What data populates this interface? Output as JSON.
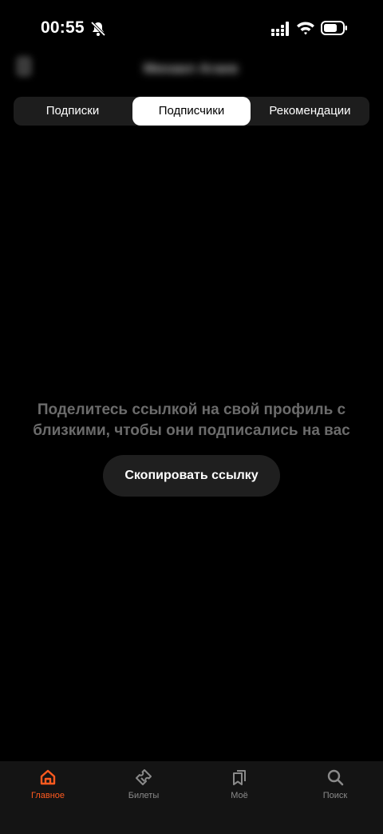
{
  "status_bar": {
    "time": "00:55",
    "icons": [
      "bell-off-icon",
      "signal-icon",
      "wifi-icon",
      "battery-icon"
    ]
  },
  "header": {
    "title": "Михаил Агаев",
    "back_icon": "chevron-left-icon"
  },
  "tabs": [
    {
      "label": "Подписки",
      "active": false
    },
    {
      "label": "Подписчики",
      "active": true
    },
    {
      "label": "Рекомендации",
      "active": false
    }
  ],
  "empty_state": {
    "line1": "Поделитесь ссылкой на свой профиль с",
    "line2": "близкими, чтобы они подписались на вас",
    "button_label": "Скопировать ссылку"
  },
  "bottom_nav": [
    {
      "label": "Главное",
      "icon": "home-icon",
      "active": true
    },
    {
      "label": "Билеты",
      "icon": "ticket-icon",
      "active": false
    },
    {
      "label": "Моё",
      "icon": "bookmark-icon",
      "active": false
    },
    {
      "label": "Поиск",
      "icon": "search-icon",
      "active": false
    }
  ],
  "colors": {
    "background": "#000000",
    "accent": "#ff5a1f",
    "tab_active_bg": "#ffffff",
    "muted_text": "#6b6b6b"
  }
}
